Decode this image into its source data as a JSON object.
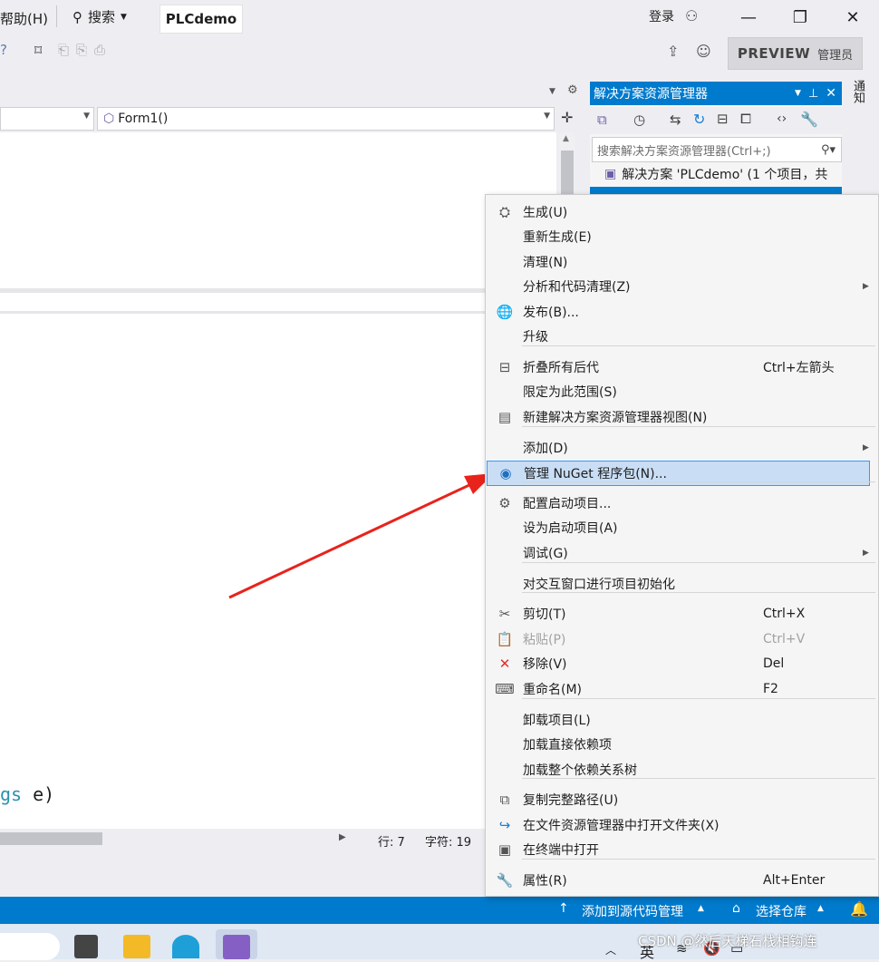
{
  "titlebar": {
    "menu_help": "帮助(H)",
    "search": "搜索",
    "project_tab": "PLCdemo",
    "login": "登录"
  },
  "toolbar": {
    "preview": "PREVIEW",
    "admin": "管理员"
  },
  "editor": {
    "nav_member": "Form1()",
    "code_fragment_type": "gs",
    "code_fragment_rest": " e)",
    "status_line": "行: 7",
    "status_char": "字符: 19"
  },
  "solution_explorer": {
    "title": "解决方案资源管理器",
    "search_placeholder": "搜索解决方案资源管理器(Ctrl+;)",
    "solution_item": "解决方案 'PLCdemo' (1 个项目，共",
    "side_tab": "通知"
  },
  "context_menu": {
    "items": [
      {
        "label": "生成(U)",
        "icon": "build-icon"
      },
      {
        "label": "重新生成(E)"
      },
      {
        "label": "清理(N)"
      },
      {
        "label": "分析和代码清理(Z)",
        "submenu": true
      },
      {
        "label": "发布(B)...",
        "icon": "globe-icon"
      },
      {
        "label": "升级"
      },
      {
        "label": "折叠所有后代",
        "shortcut": "Ctrl+左箭头",
        "icon": "collapse-icon"
      },
      {
        "label": "限定为此范围(S)"
      },
      {
        "label": "新建解决方案资源管理器视图(N)",
        "icon": "new-view-icon"
      },
      {
        "label": "添加(D)",
        "submenu": true
      },
      {
        "label": "管理 NuGet 程序包(N)...",
        "icon": "nuget-icon",
        "highlighted": true
      },
      {
        "label": "配置启动项目...",
        "icon": "gear-icon"
      },
      {
        "label": "设为启动项目(A)"
      },
      {
        "label": "调试(G)",
        "submenu": true
      },
      {
        "label": "对交互窗口进行项目初始化"
      },
      {
        "label": "剪切(T)",
        "shortcut": "Ctrl+X",
        "icon": "scissors-icon"
      },
      {
        "label": "粘贴(P)",
        "shortcut": "Ctrl+V",
        "icon": "paste-icon",
        "disabled": true
      },
      {
        "label": "移除(V)",
        "shortcut": "Del",
        "icon": "remove-icon"
      },
      {
        "label": "重命名(M)",
        "shortcut": "F2",
        "icon": "rename-icon"
      },
      {
        "label": "卸载项目(L)"
      },
      {
        "label": "加载直接依赖项"
      },
      {
        "label": "加载整个依赖关系树"
      },
      {
        "label": "复制完整路径(U)",
        "icon": "copy-icon"
      },
      {
        "label": "在文件资源管理器中打开文件夹(X)",
        "icon": "open-folder-icon"
      },
      {
        "label": "在终端中打开",
        "icon": "terminal-icon"
      },
      {
        "label": "属性(R)",
        "shortcut": "Alt+Enter",
        "icon": "wrench-icon"
      }
    ]
  },
  "statusbar": {
    "source_control": "添加到源代码管理",
    "repo": "选择仓库"
  },
  "taskbar": {
    "ime": "英",
    "watermark": "CSDN @然后天梯石栈相钩连"
  },
  "colors": {
    "accent": "#007acc",
    "highlight": "#c9def5",
    "arrow": "#e8231b"
  }
}
